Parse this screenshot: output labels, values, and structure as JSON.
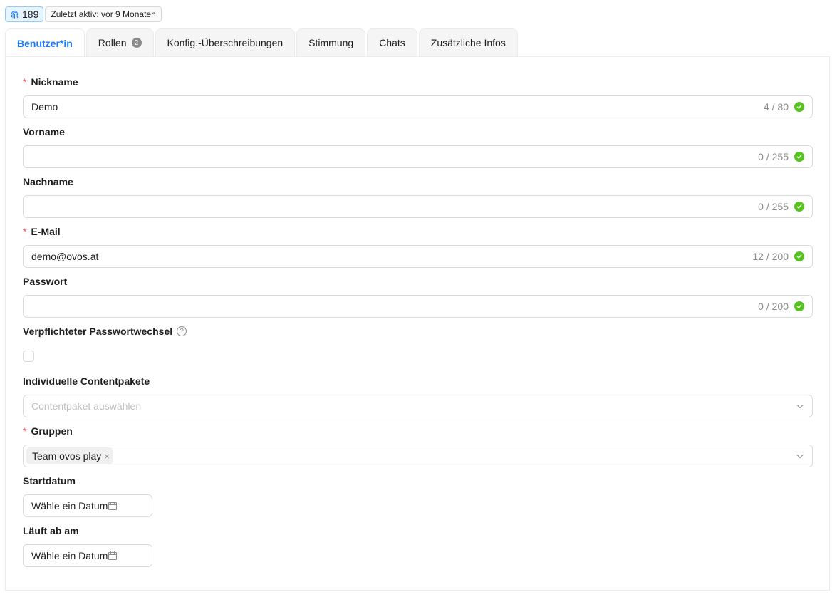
{
  "header": {
    "id_value": "189",
    "last_active": "Zuletzt aktiv: vor 9 Monaten"
  },
  "tabs": [
    {
      "label": "Benutzer*in",
      "active": true
    },
    {
      "label": "Rollen",
      "count": "2"
    },
    {
      "label": "Konfig.-Überschreibungen"
    },
    {
      "label": "Stimmung"
    },
    {
      "label": "Chats"
    },
    {
      "label": "Zusätzliche Infos"
    }
  ],
  "form": {
    "nickname": {
      "label": "Nickname",
      "required_mark": "*",
      "value": "Demo",
      "counter": "4 / 80"
    },
    "vorname": {
      "label": "Vorname",
      "value": "",
      "counter": "0 / 255"
    },
    "nachname": {
      "label": "Nachname",
      "value": "",
      "counter": "0 / 255"
    },
    "email": {
      "label": "E-Mail",
      "required_mark": "*",
      "value": "demo@ovos.at",
      "counter": "12 / 200"
    },
    "passwort": {
      "label": "Passwort",
      "value": "",
      "counter": "0 / 200"
    },
    "passwortwechsel": {
      "label": "Verpflichteter Passwortwechsel",
      "help": "?",
      "checked": false
    },
    "contentpakete": {
      "label": "Individuelle Contentpakete",
      "placeholder": "Contentpaket auswählen"
    },
    "gruppen": {
      "label": "Gruppen",
      "required_mark": "*",
      "tags": [
        "Team ovos play"
      ],
      "remove_glyph": "×"
    },
    "startdatum": {
      "label": "Startdatum",
      "placeholder": "Wähle ein Datum"
    },
    "ablauf": {
      "label": "Läuft ab am",
      "placeholder": "Wähle ein Datum"
    }
  },
  "colors": {
    "accent": "#1677ff",
    "success": "#52c41a",
    "required": "#ff4d4f"
  }
}
